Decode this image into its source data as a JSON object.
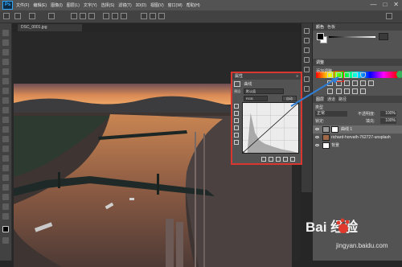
{
  "menubar": {
    "logo": "Ps",
    "items": [
      "文件(F)",
      "编辑(E)",
      "图像(I)",
      "图层(L)",
      "文字(Y)",
      "选择(S)",
      "滤镜(T)",
      "3D(D)",
      "视图(V)",
      "窗口(W)",
      "帮助(H)"
    ],
    "minimize": "—",
    "maximize": "□",
    "close": "✕"
  },
  "document": {
    "tab_label": "DSC_0001.jpg"
  },
  "right_panels": {
    "color_tabs": [
      "颜色",
      "色板"
    ],
    "adjust_tabs": [
      "调整"
    ],
    "adjust_label": "添加调整",
    "layers_tabs": [
      "图层",
      "通道",
      "路径"
    ],
    "layers_kind": "类型",
    "blend_mode": "正常",
    "opacity_label": "不透明度:",
    "opacity_value": "100%",
    "lock_label": "锁定:",
    "fill_label": "填充:",
    "fill_value": "100%",
    "layers": [
      {
        "name": "曲线 1",
        "selected": true
      },
      {
        "name": "richard-horvath-762727-unsplash",
        "selected": false
      },
      {
        "name": "背景",
        "selected": false
      }
    ]
  },
  "properties": {
    "header": "属性",
    "title": "曲线",
    "preset_label": "预设:",
    "preset_value": "默认值",
    "channel_value": "RGB",
    "auto_label": "自动"
  },
  "curve": {
    "points": [
      [
        0,
        0
      ],
      [
        255,
        255
      ]
    ]
  },
  "colors": {
    "accent_red": "#d8362f",
    "selection_blue": "#2f7fd6",
    "status_green": "#36b05a"
  },
  "watermark": {
    "brand": "Bai 经验",
    "sub": "jingyan.baidu.com"
  }
}
